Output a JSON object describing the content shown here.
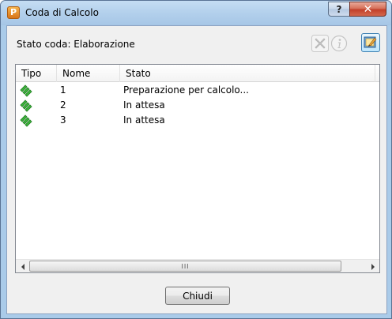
{
  "window": {
    "title": "Coda di Calcolo",
    "app_icon_letter": "P",
    "help_label": "?",
    "close_label": "✕"
  },
  "queue": {
    "status_text": "Stato coda: Elaborazione"
  },
  "toolbar": {
    "cancel_icon": "cancel-x-icon",
    "info_icon": "info-icon",
    "settings_icon": "settings-icon"
  },
  "list": {
    "columns": [
      "Tipo",
      "Nome",
      "Stato"
    ],
    "rows": [
      {
        "type_icon": "render-job-icon",
        "name": "1",
        "status": "Preparazione per calcolo..."
      },
      {
        "type_icon": "render-job-icon",
        "name": "2",
        "status": "In attesa"
      },
      {
        "type_icon": "render-job-icon",
        "name": "3",
        "status": "In attesa"
      }
    ],
    "scrollbar_grip": "III"
  },
  "footer": {
    "close_button_label": "Chiudi"
  },
  "colors": {
    "job_icon_green": "#2e9e2e",
    "titlebar": "#b3d0ec",
    "close_button_red": "#c2402a"
  }
}
